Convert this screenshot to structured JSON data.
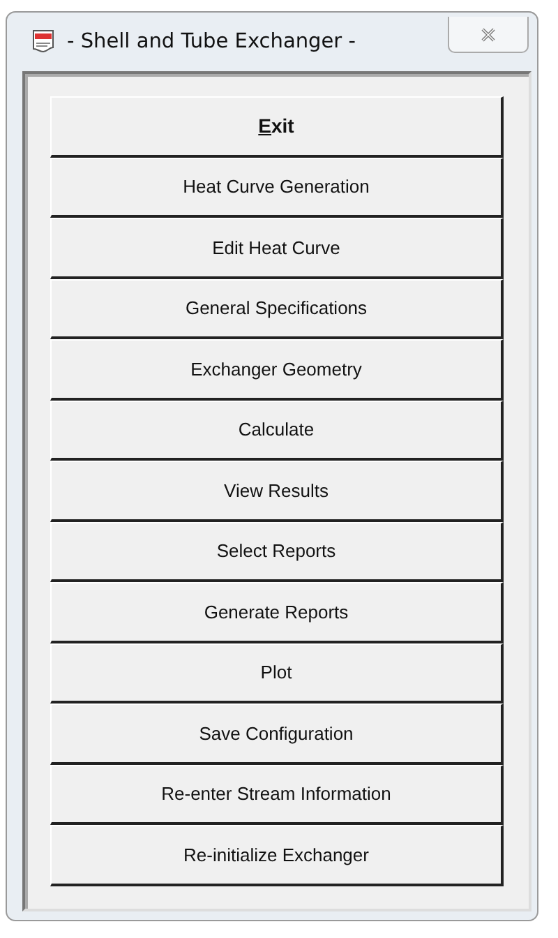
{
  "window": {
    "title": "- Shell and Tube Exchanger -"
  },
  "buttons": [
    {
      "label": "Exit",
      "bold": true,
      "underline_first": true
    },
    {
      "label": "Heat Curve Generation",
      "bold": false,
      "underline_first": false
    },
    {
      "label": "Edit Heat Curve",
      "bold": false,
      "underline_first": false
    },
    {
      "label": "General Specifications",
      "bold": false,
      "underline_first": false
    },
    {
      "label": "Exchanger Geometry",
      "bold": false,
      "underline_first": false
    },
    {
      "label": "Calculate",
      "bold": false,
      "underline_first": false
    },
    {
      "label": "View Results",
      "bold": false,
      "underline_first": false
    },
    {
      "label": "Select Reports",
      "bold": false,
      "underline_first": false
    },
    {
      "label": "Generate Reports",
      "bold": false,
      "underline_first": false
    },
    {
      "label": "Plot",
      "bold": false,
      "underline_first": false
    },
    {
      "label": "Save Configuration",
      "bold": false,
      "underline_first": false
    },
    {
      "label": "Re-enter Stream Information",
      "bold": false,
      "underline_first": false
    },
    {
      "label": "Re-initialize Exchanger",
      "bold": false,
      "underline_first": false
    }
  ]
}
